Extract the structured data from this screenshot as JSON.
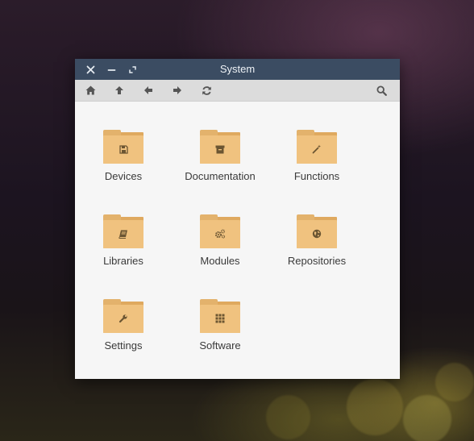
{
  "window": {
    "title": "System"
  },
  "titlebar": {
    "buttons": [
      {
        "icon": "close-icon"
      },
      {
        "icon": "minimize-icon"
      },
      {
        "icon": "maximize-icon"
      }
    ]
  },
  "toolbar": {
    "buttons": [
      {
        "icon": "home-icon"
      },
      {
        "icon": "arrow-up-icon"
      },
      {
        "icon": "arrow-left-icon"
      },
      {
        "icon": "arrow-right-icon"
      },
      {
        "icon": "refresh-icon"
      },
      {
        "icon": "search-icon"
      }
    ]
  },
  "files": {
    "items": [
      {
        "label": "Devices",
        "emblem": "floppy-disk-icon"
      },
      {
        "label": "Documentation",
        "emblem": "archive-box-icon"
      },
      {
        "label": "Functions",
        "emblem": "magic-wand-icon"
      },
      {
        "label": "Libraries",
        "emblem": "book-icon"
      },
      {
        "label": "Modules",
        "emblem": "gears-icon"
      },
      {
        "label": "Repositories",
        "emblem": "globe-icon"
      },
      {
        "label": "Settings",
        "emblem": "wrench-icon"
      },
      {
        "label": "Software",
        "emblem": "grid-icon"
      }
    ]
  },
  "colors": {
    "titlebar": "#3b4c62",
    "toolbar": "#dcdcdc",
    "folder": "#f0c27f",
    "folder_dark": "#dfa95f",
    "emblem": "#6b5532"
  }
}
